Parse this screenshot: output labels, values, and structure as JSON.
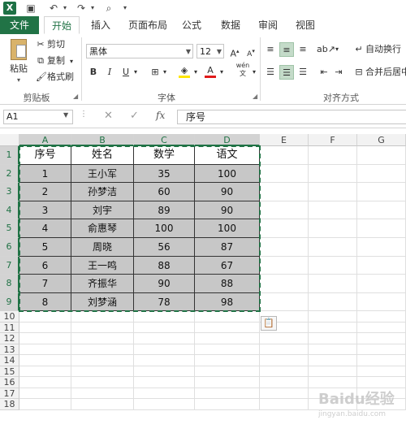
{
  "app": {
    "logo": "X"
  },
  "quick_access": {
    "save_icon": "save-icon",
    "undo_icon": "undo-icon",
    "redo_icon": "redo-icon",
    "preview_icon": "print-preview-icon"
  },
  "tabs": [
    "文件",
    "开始",
    "插入",
    "页面布局",
    "公式",
    "数据",
    "审阅",
    "视图"
  ],
  "clipboard": {
    "paste": "粘贴",
    "cut": "剪切",
    "copy": "复制",
    "format_painter": "格式刷",
    "group": "剪贴板"
  },
  "font": {
    "name": "黑体",
    "size": "12",
    "bold": "B",
    "italic": "I",
    "underline": "U",
    "phonetic": "wén",
    "group": "字体",
    "accent": "#217346",
    "font_color": "#e01b1b",
    "fill_color": "#ffe600"
  },
  "alignment": {
    "wrap": "自动换行",
    "merge": "合并后居中",
    "group": "对齐方式"
  },
  "formula_bar": {
    "name_box": "A1",
    "cancel": "✕",
    "enter": "✓",
    "fx": "fx",
    "value": "序号"
  },
  "columns": [
    "A",
    "B",
    "C",
    "D",
    "E",
    "F",
    "G"
  ],
  "rows": [
    "1",
    "2",
    "3",
    "4",
    "5",
    "6",
    "7",
    "8",
    "9",
    "10",
    "11",
    "12",
    "13",
    "14",
    "15",
    "16",
    "17",
    "18"
  ],
  "table": {
    "headers": [
      "序号",
      "姓名",
      "数学",
      "语文"
    ],
    "rows": [
      [
        "1",
        "王小军",
        "35",
        "100"
      ],
      [
        "2",
        "孙梦洁",
        "60",
        "90"
      ],
      [
        "3",
        "刘宇",
        "89",
        "90"
      ],
      [
        "4",
        "俞惠琴",
        "100",
        "100"
      ],
      [
        "5",
        "周晓",
        "56",
        "87"
      ],
      [
        "6",
        "王一鸣",
        "88",
        "67"
      ],
      [
        "7",
        "齐振华",
        "90",
        "88"
      ],
      [
        "8",
        "刘梦涵",
        "78",
        "98"
      ]
    ]
  },
  "watermark": {
    "text": "Baidu经验",
    "sub": "jingyan.baidu.com"
  }
}
